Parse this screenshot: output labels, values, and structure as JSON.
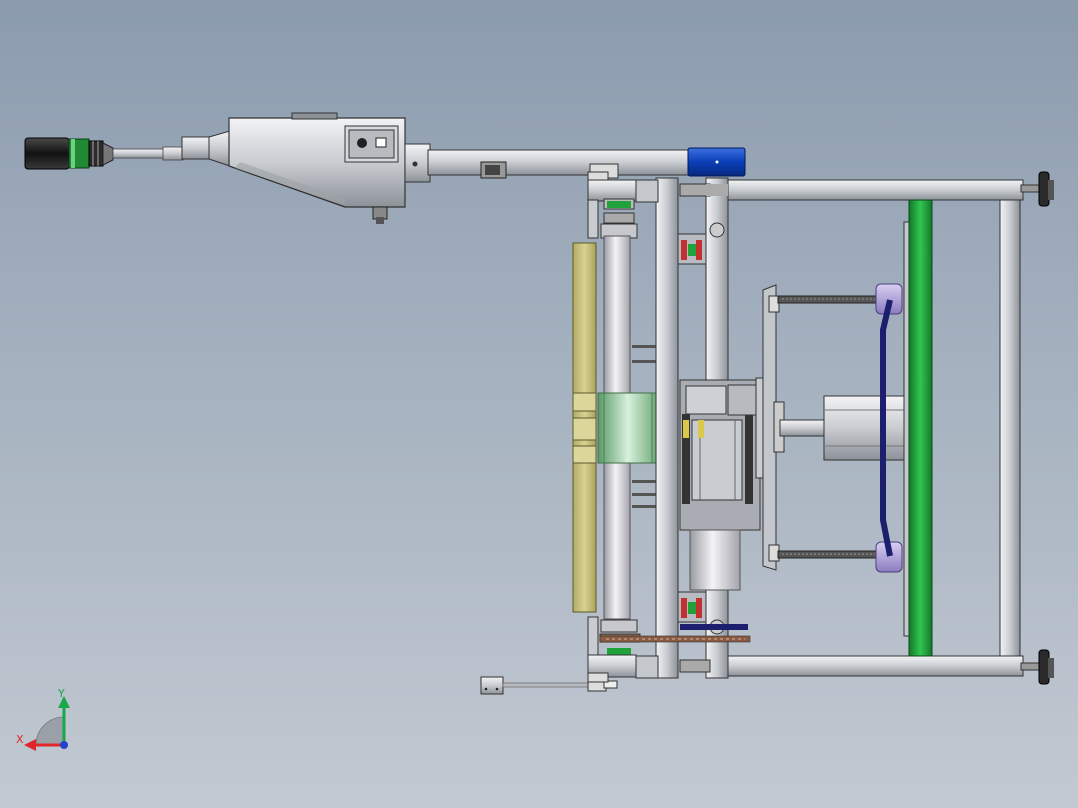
{
  "triad": {
    "x_label": "X",
    "y_label": "Y",
    "x_color": "#e0262a",
    "y_color": "#17a84a",
    "z_color": "#2244cc"
  },
  "colors": {
    "steel": "#c9ccd1",
    "steel_dark": "#8d9299",
    "rail_green": "#1fa23a",
    "motor_blue": "#0b3fb8",
    "cylinder_purple": "#a99bd6",
    "guide_plate_olive": "#c9c27e",
    "belt_navy": "#1b1f6e",
    "roller_green": "#8fd39d"
  }
}
